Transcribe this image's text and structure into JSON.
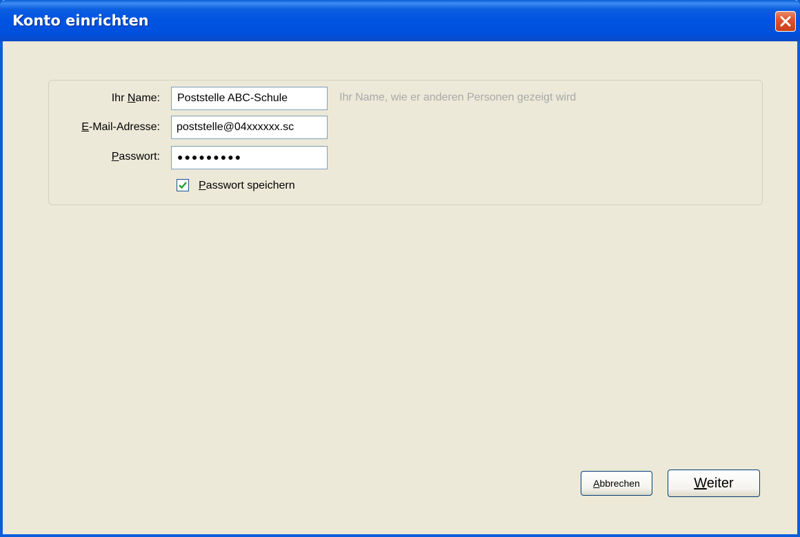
{
  "window": {
    "title": "Konto einrichten",
    "close_icon": "close-icon"
  },
  "form": {
    "name_label_pre": "Ihr ",
    "name_label_key": "N",
    "name_label_post": "ame:",
    "name_value": "Poststelle ABC-Schule",
    "name_hint": "Ihr Name, wie er anderen Personen gezeigt wird",
    "email_label_key": "E",
    "email_label_post": "-Mail-Adresse:",
    "email_value": "poststelle@04xxxxxx.sc",
    "password_label_key": "P",
    "password_label_post": "asswort:",
    "password_value": "●●●●●●●●●",
    "save_password_checked": true,
    "save_password_key": "P",
    "save_password_post": "asswort speichern"
  },
  "buttons": {
    "cancel_key": "A",
    "cancel_post": "bbrechen",
    "next_key": "W",
    "next_post": "eiter"
  },
  "colors": {
    "titlebar": "#0053e0",
    "dialog_bg": "#ece9d8",
    "close_button": "#e0542e",
    "check_mark": "#21a121"
  }
}
